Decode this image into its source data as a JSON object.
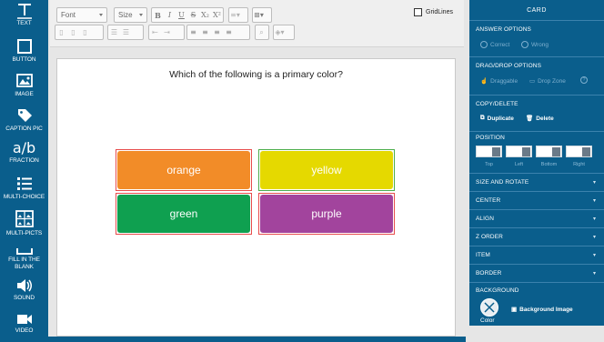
{
  "sidebar": {
    "tools": [
      {
        "label": "TEXT",
        "icon": "text-tool-icon"
      },
      {
        "label": "BUTTON",
        "icon": "button-tool-icon"
      },
      {
        "label": "IMAGE",
        "icon": "image-tool-icon"
      },
      {
        "label": "CAPTION PIC",
        "icon": "tag-icon"
      },
      {
        "label": "FRACTION",
        "icon": "fraction-icon"
      },
      {
        "label": "MULTI-CHOICE",
        "icon": "list-icon"
      },
      {
        "label": "MULTI-PICTS",
        "icon": "multi-picture-icon"
      },
      {
        "label": "FILL IN THE BLANK",
        "icon": "blank-line-icon"
      },
      {
        "label": "SOUND",
        "icon": "speaker-icon"
      },
      {
        "label": "VIDEO",
        "icon": "video-camera-icon"
      }
    ],
    "fraction_glyph": "a/b"
  },
  "toolbar": {
    "font_placeholder": "Font",
    "size_placeholder": "Size",
    "bold": "B",
    "italic": "I",
    "underline": "U",
    "strike": "S",
    "subscript": "X₂",
    "superscript": "X²",
    "gridlines_label": "GridLines"
  },
  "canvas": {
    "question": "Which of the following is a primary color?",
    "answers": [
      {
        "label": "orange",
        "color": "#f28c28"
      },
      {
        "label": "yellow",
        "color": "#e5d900"
      },
      {
        "label": "green",
        "color": "#0fa050"
      },
      {
        "label": "purple",
        "color": "#a2449d"
      }
    ]
  },
  "panel": {
    "title": "CARD",
    "answer_options": {
      "heading": "ANSWER OPTIONS",
      "correct": "Correct",
      "wrong": "Wrong"
    },
    "dragdrop": {
      "heading": "DRAG/DROP OPTIONS",
      "draggable": "Draggable",
      "dropzone": "Drop Zone",
      "help": "?"
    },
    "copydelete": {
      "heading": "COPY/DELETE",
      "duplicate": "Duplicate",
      "delete": "Delete"
    },
    "position": {
      "heading": "POSITION",
      "top": "Top",
      "left": "Left",
      "bottom": "Bottom",
      "right": "Right"
    },
    "collapsed": [
      "SIZE AND ROTATE",
      "CENTER",
      "ALIGN",
      "Z ORDER",
      "ITEM",
      "BORDER"
    ],
    "background": {
      "heading": "BACKGROUND",
      "color": "Color",
      "image": "Background Image"
    }
  },
  "colors": {
    "sidebar_blue": "#0a5e8c",
    "answer_border_red": "#e74c4c",
    "answer_border_green": "#4cae4c"
  }
}
